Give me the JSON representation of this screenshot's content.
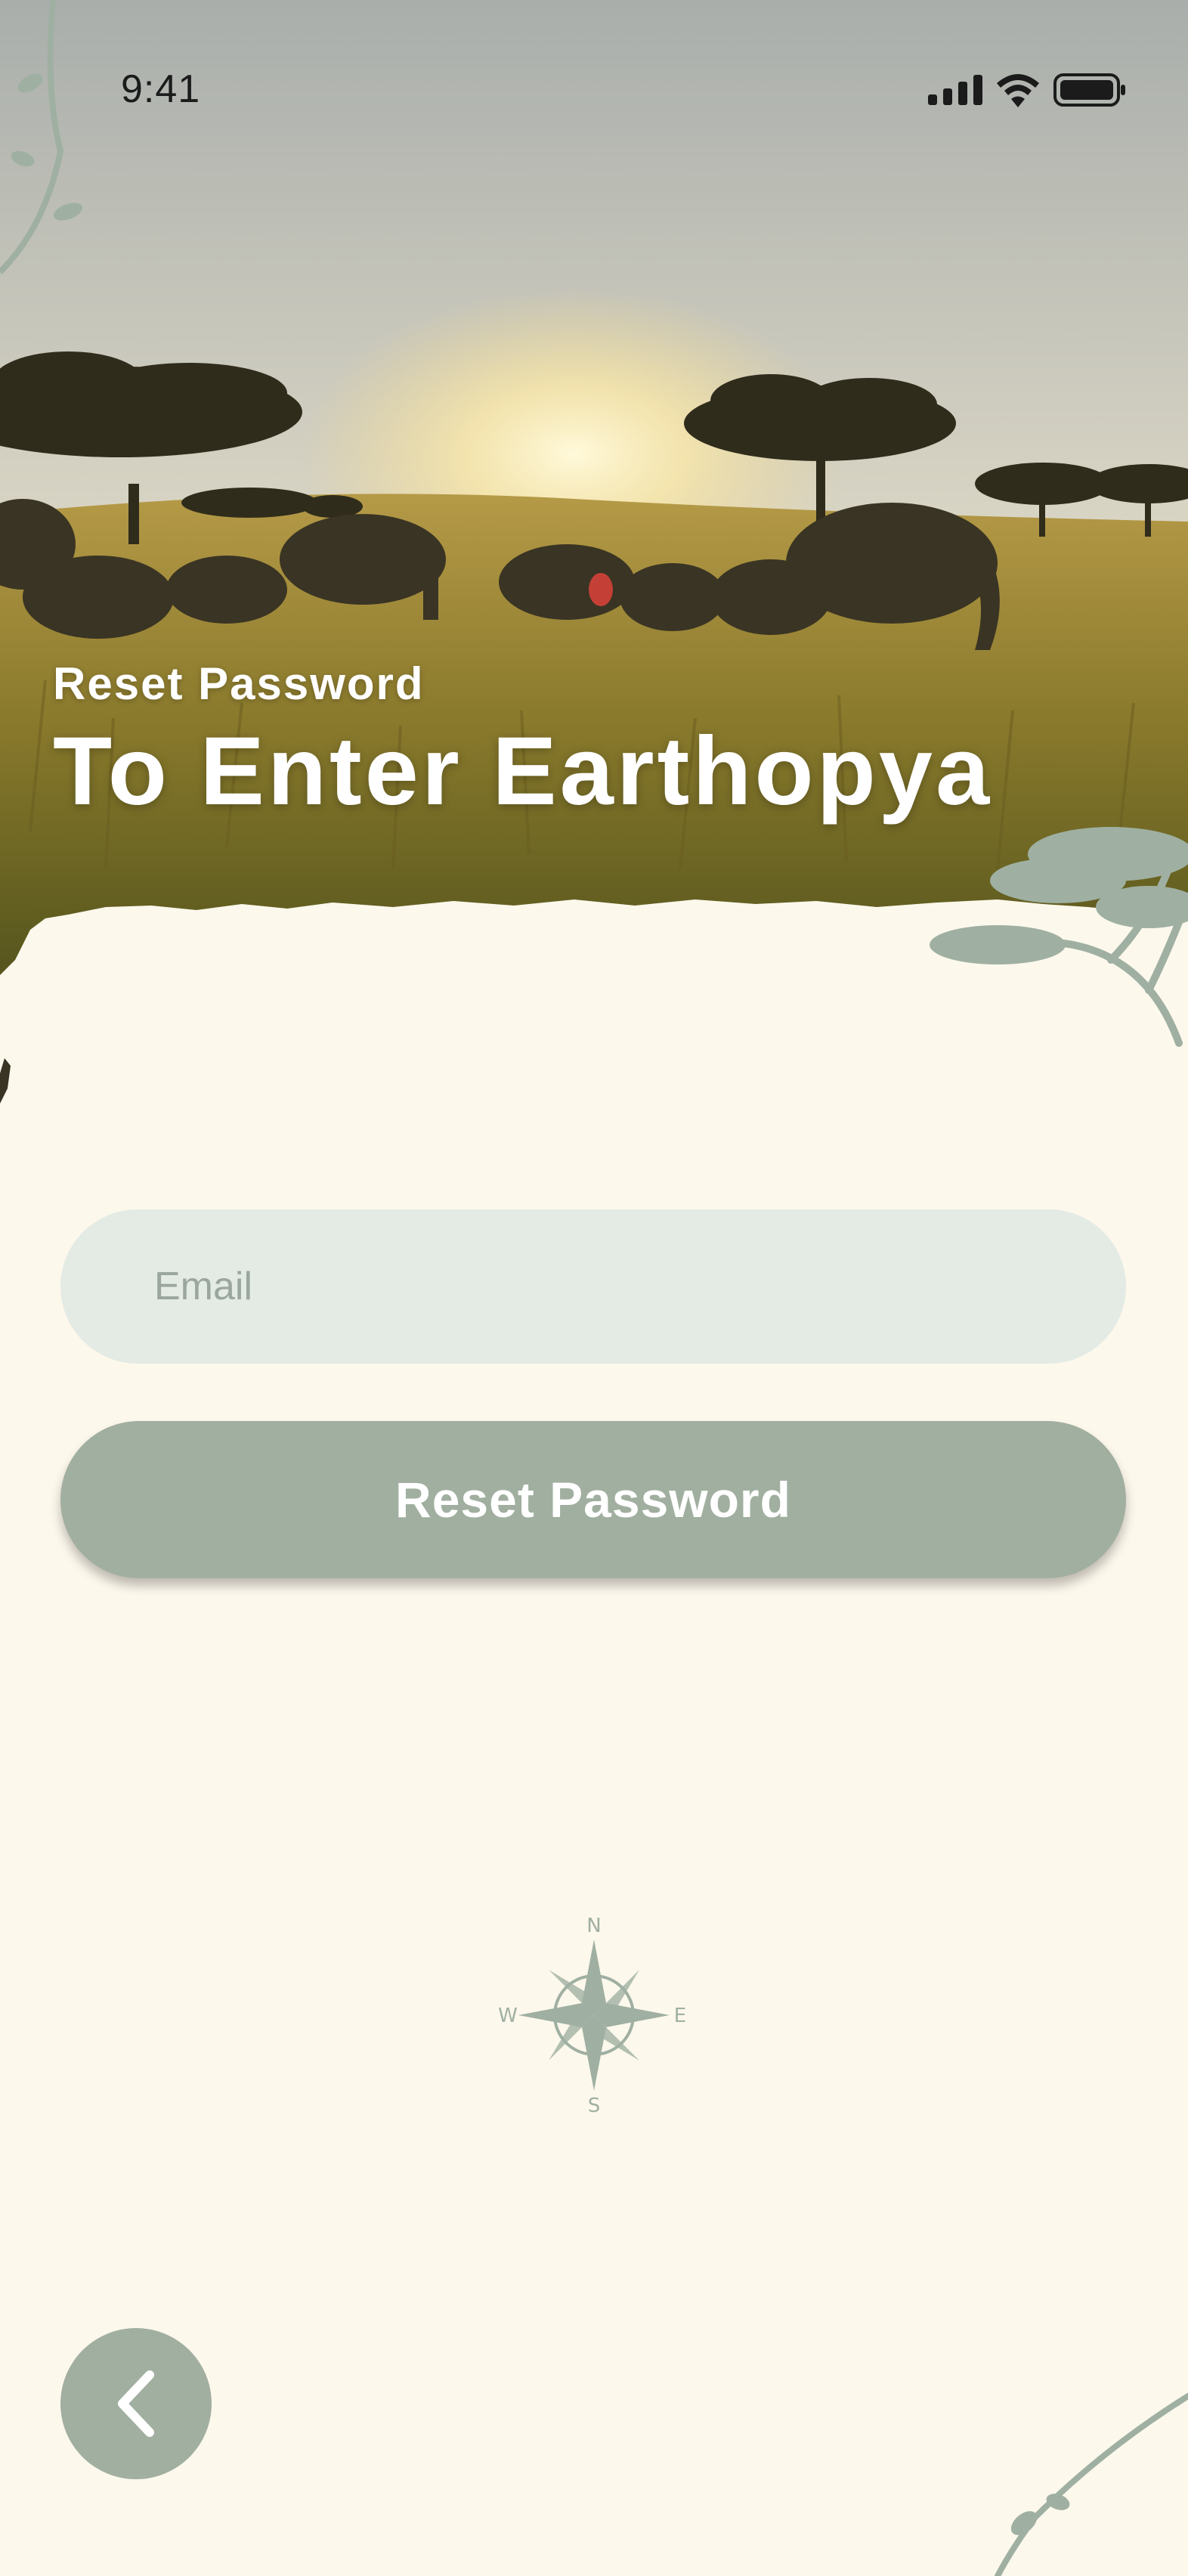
{
  "status_bar": {
    "time": "9:41",
    "icons": [
      "cellular-signal-icon",
      "wifi-icon",
      "battery-icon"
    ]
  },
  "header": {
    "subtitle": "Reset Password",
    "title": "To Enter Earthopya"
  },
  "form": {
    "email_placeholder": "Email",
    "email_value": "",
    "submit_label": "Reset Password"
  },
  "compass": {
    "north": "N",
    "south": "S",
    "east": "E",
    "west": "W"
  },
  "navigation": {
    "back_icon": "chevron-left-icon"
  },
  "colors": {
    "background": "#fdf8ec",
    "input_fill": "#e3ebe4",
    "button_fill": "#a1afa0",
    "accent_sage": "#9fb0a2",
    "text_light": "#ffffff"
  }
}
